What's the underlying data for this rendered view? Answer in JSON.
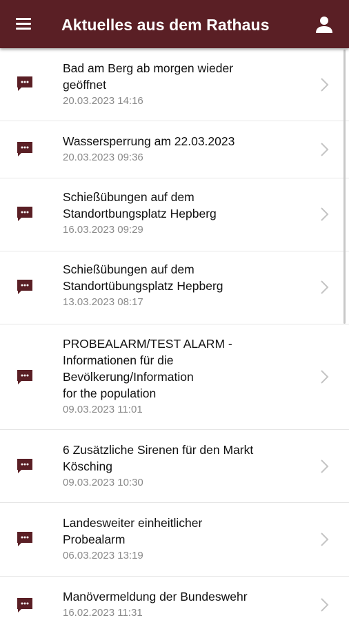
{
  "header": {
    "title": "Aktuelles aus dem Rathaus",
    "background": "#5a1f25"
  },
  "icons": {
    "menu": "hamburger-menu-icon",
    "account": "user-icon",
    "item": "speech-bubble-icon",
    "chevron": "chevron-right-icon"
  },
  "news": {
    "items": [
      {
        "title": "Bad am Berg ab morgen wieder\ngeöffnet",
        "date": "20.03.2023 14:16"
      },
      {
        "title": "Wassersperrung am 22.03.2023",
        "date": "20.03.2023 09:36"
      },
      {
        "title": "Schießübungen auf dem\nStandortbungsplatz Hepberg",
        "date": "16.03.2023 09:29"
      },
      {
        "title": "Schießübungen auf dem\nStandortübungsplatz Hepberg",
        "date": "13.03.2023 08:17"
      },
      {
        "title": "PROBEALARM/TEST ALARM -\nInformationen für die\nBevölkerung/Information\nfor the population",
        "date": "09.03.2023 11:01"
      },
      {
        "title": "6 Zusätzliche Sirenen für den Markt\nKösching",
        "date": "09.03.2023 10:30"
      },
      {
        "title": "Landesweiter einheitlicher\nProbealarm",
        "date": "06.03.2023 13:19"
      },
      {
        "title": "Manövermeldung der Bundeswehr",
        "date": "16.02.2023 11:31"
      }
    ]
  }
}
